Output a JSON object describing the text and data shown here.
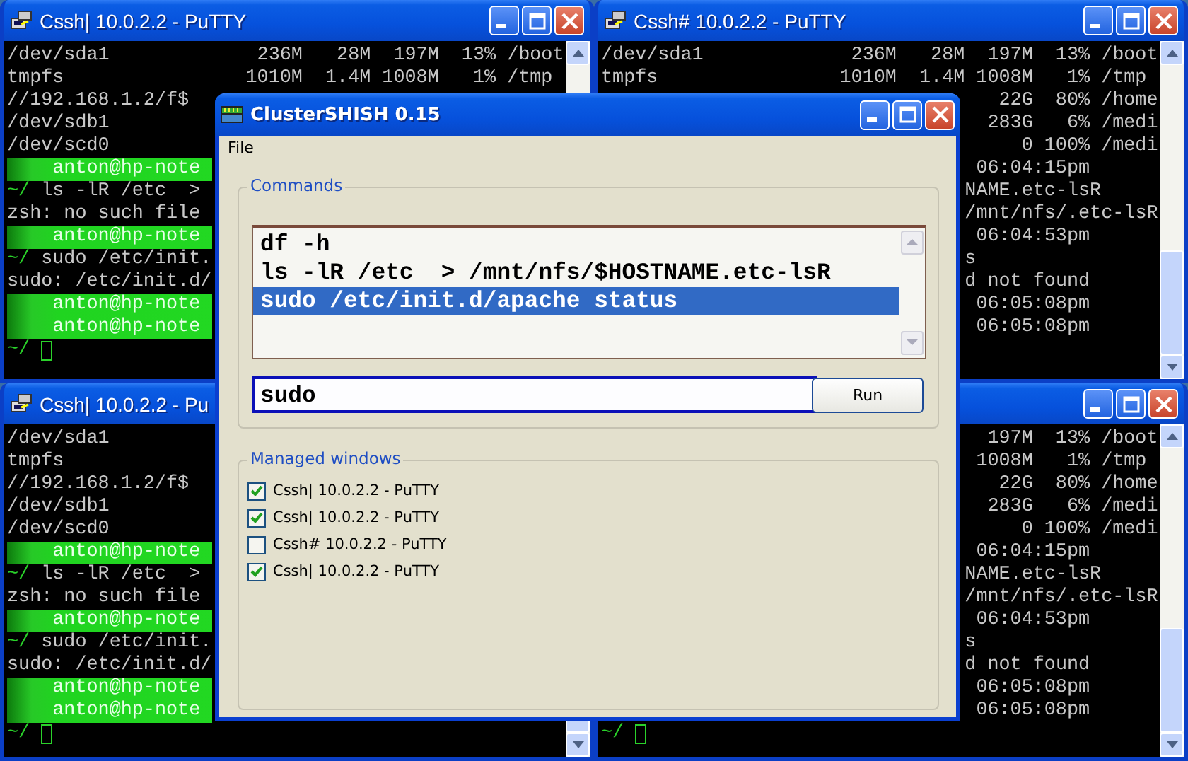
{
  "terminals": [
    {
      "title": "Cssh| 10.0.2.2 - PuTTY",
      "caption_buttons": true,
      "lines": [
        {
          "kind": "output",
          "text": "/dev/sda1             236M   28M  197M  13% /boot"
        },
        {
          "kind": "output",
          "text": "tmpfs                1010M  1.4M 1008M   1% /tmp"
        },
        {
          "kind": "output",
          "text": "//192.168.1.2/f$"
        },
        {
          "kind": "output",
          "text": "/dev/sdb1"
        },
        {
          "kind": "output",
          "text": "/dev/scd0"
        },
        {
          "kind": "prompt",
          "user": "anton@hp-note"
        },
        {
          "kind": "command",
          "prompt": "~/",
          "text": "ls -lR /etc  >"
        },
        {
          "kind": "output",
          "text": "zsh: no such file"
        },
        {
          "kind": "prompt",
          "user": "anton@hp-note"
        },
        {
          "kind": "command",
          "prompt": "~/",
          "text": "sudo /etc/init."
        },
        {
          "kind": "output",
          "text": "sudo: /etc/init.d/"
        },
        {
          "kind": "prompt",
          "user": "anton@hp-note"
        },
        {
          "kind": "prompt",
          "user": "anton@hp-note"
        },
        {
          "kind": "command",
          "prompt": "~/",
          "cursor": true
        }
      ]
    },
    {
      "title": "Cssh# 10.0.2.2 - PuTTY",
      "caption_buttons": true,
      "lines": [
        {
          "kind": "output",
          "text": "/dev/sda1             236M   28M  197M  13% /boot"
        },
        {
          "kind": "output",
          "text": "tmpfs                1010M  1.4M 1008M   1% /tmp"
        },
        {
          "kind": "output",
          "text": "                                   22G  80% /home"
        },
        {
          "kind": "output",
          "text": "                                  283G   6% /medi"
        },
        {
          "kind": "output",
          "text": "                                     0 100% /medi"
        },
        {
          "kind": "output",
          "text": "                                 06:04:15pm"
        },
        {
          "kind": "output",
          "text": "                                NAME.etc-lsR"
        },
        {
          "kind": "output",
          "text": "                                /mnt/nfs/.etc-lsR"
        },
        {
          "kind": "output",
          "text": "                                 06:04:53pm"
        },
        {
          "kind": "output",
          "text": "                                s"
        },
        {
          "kind": "output",
          "text": "                                d not found"
        },
        {
          "kind": "output",
          "text": "                                 06:05:08pm"
        },
        {
          "kind": "output",
          "text": "                                 06:05:08pm"
        }
      ]
    },
    {
      "title": "Cssh| 10.0.2.2 - Pu",
      "caption_buttons": false,
      "lines": [
        {
          "kind": "output",
          "text": "/dev/sda1"
        },
        {
          "kind": "output",
          "text": "tmpfs"
        },
        {
          "kind": "output",
          "text": "//192.168.1.2/f$"
        },
        {
          "kind": "output",
          "text": "/dev/sdb1"
        },
        {
          "kind": "output",
          "text": "/dev/scd0"
        },
        {
          "kind": "prompt",
          "user": "anton@hp-note"
        },
        {
          "kind": "command",
          "prompt": "~/",
          "text": "ls -lR /etc  >"
        },
        {
          "kind": "output",
          "text": "zsh: no such file"
        },
        {
          "kind": "prompt",
          "user": "anton@hp-note"
        },
        {
          "kind": "command",
          "prompt": "~/",
          "text": "sudo /etc/init."
        },
        {
          "kind": "output",
          "text": "sudo: /etc/init.d/"
        },
        {
          "kind": "prompt",
          "user": "anton@hp-note"
        },
        {
          "kind": "prompt",
          "user": "anton@hp-note"
        },
        {
          "kind": "command",
          "prompt": "~/",
          "cursor": true
        }
      ]
    },
    {
      "caption_buttons": true,
      "lines": [
        {
          "kind": "output",
          "text": "                                  197M  13% /boot"
        },
        {
          "kind": "output",
          "text": "                                 1008M   1% /tmp"
        },
        {
          "kind": "output",
          "text": "                                   22G  80% /home"
        },
        {
          "kind": "output",
          "text": "                                  283G   6% /medi"
        },
        {
          "kind": "output",
          "text": "                                     0 100% /medi"
        },
        {
          "kind": "output",
          "text": "                                 06:04:15pm"
        },
        {
          "kind": "output",
          "text": "                                NAME.etc-lsR"
        },
        {
          "kind": "output",
          "text": "                                /mnt/nfs/.etc-lsR"
        },
        {
          "kind": "output",
          "text": "                                 06:04:53pm"
        },
        {
          "kind": "output",
          "text": "                                s"
        },
        {
          "kind": "output",
          "text": "                                d not found"
        },
        {
          "kind": "output",
          "text": "                                 06:05:08pm"
        },
        {
          "kind": "output",
          "text": "                                 06:05:08pm"
        },
        {
          "kind": "command",
          "prompt": "~/",
          "cursor": true
        }
      ]
    }
  ],
  "dialog": {
    "title": "ClusterSHISH 0.15",
    "menu": [
      "File"
    ],
    "commands": {
      "label": "Commands",
      "items": [
        {
          "text": "df -h",
          "selected": false
        },
        {
          "text": "ls -lR /etc  > /mnt/nfs/$HOSTNAME.etc-lsR",
          "selected": false
        },
        {
          "text": "sudo /etc/init.d/apache status",
          "selected": true
        }
      ],
      "input": {
        "value": "sudo"
      },
      "button": "Run"
    },
    "managed": {
      "label": "Managed windows",
      "items": [
        {
          "label": "Cssh| 10.0.2.2 - PuTTY",
          "checked": true
        },
        {
          "label": "Cssh| 10.0.2.2 - PuTTY",
          "checked": true
        },
        {
          "label": "Cssh# 10.0.2.2 - PuTTY",
          "checked": false
        },
        {
          "label": "Cssh| 10.0.2.2 - PuTTY",
          "checked": true
        }
      ]
    }
  }
}
